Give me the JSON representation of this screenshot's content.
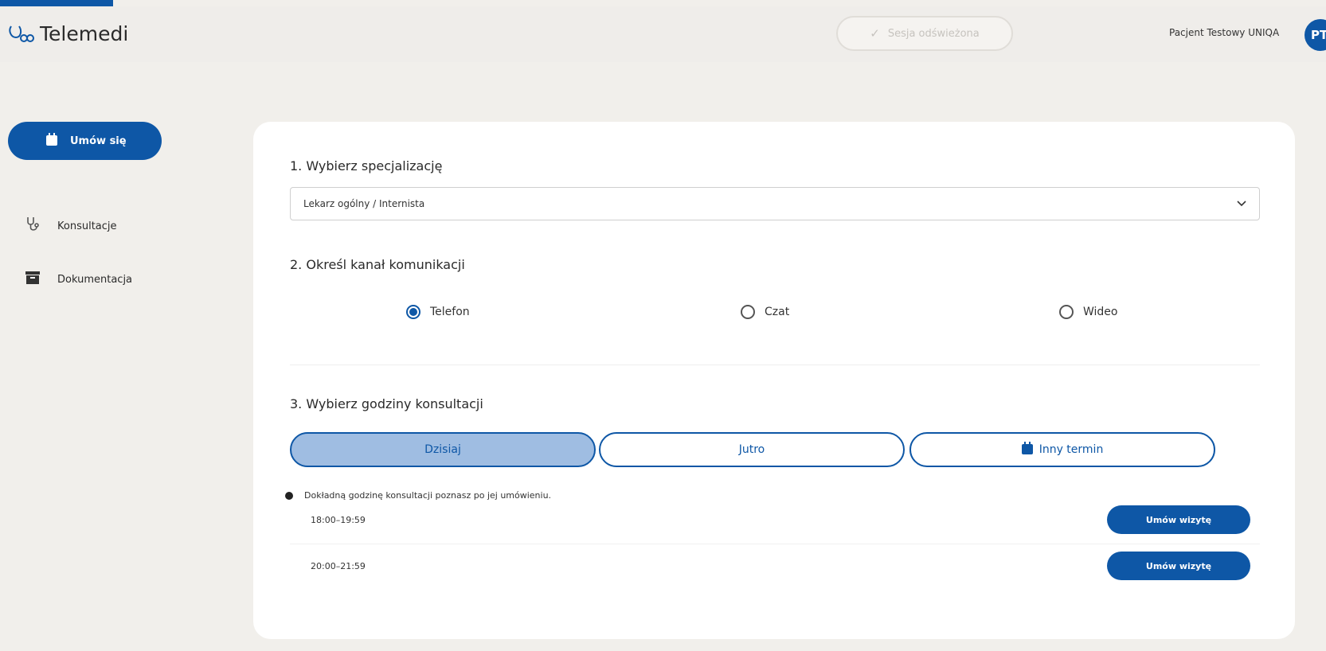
{
  "header": {
    "logo_text": "Telemedi",
    "session_label": "Sesja odświeżona",
    "user_name": "Pacjent Testowy UNIQA",
    "avatar_initials": "PT"
  },
  "sidebar": {
    "book_label": "Umów się",
    "items": [
      {
        "label": "Konsultacje",
        "icon": "stethoscope-icon"
      },
      {
        "label": "Dokumentacja",
        "icon": "archive-box-icon"
      }
    ]
  },
  "form": {
    "step1_title": "1. Wybierz specjalizację",
    "specialization_value": "Lekarz ogólny / Internista",
    "step2_title": "2. Określ kanał komunikacji",
    "channels": [
      {
        "label": "Telefon",
        "selected": true
      },
      {
        "label": "Czat",
        "selected": false
      },
      {
        "label": "Wideo",
        "selected": false
      }
    ],
    "step3_title": "3. Wybierz godziny konsultacji",
    "days": [
      {
        "label": "Dzisiaj",
        "active": true
      },
      {
        "label": "Jutro",
        "active": false
      },
      {
        "label": "Inny termin",
        "active": false
      }
    ],
    "info_text": "Dokładną godzinę konsultacji poznasz po jej umówieniu.",
    "slots": [
      {
        "time": "18:00–19:59",
        "button": "Umów wizytę"
      },
      {
        "time": "20:00–21:59",
        "button": "Umów wizytę"
      }
    ]
  },
  "colors": {
    "primary": "#0e57a6",
    "active_day_bg": "#9fbde2",
    "page_bg": "#f1efeb"
  }
}
